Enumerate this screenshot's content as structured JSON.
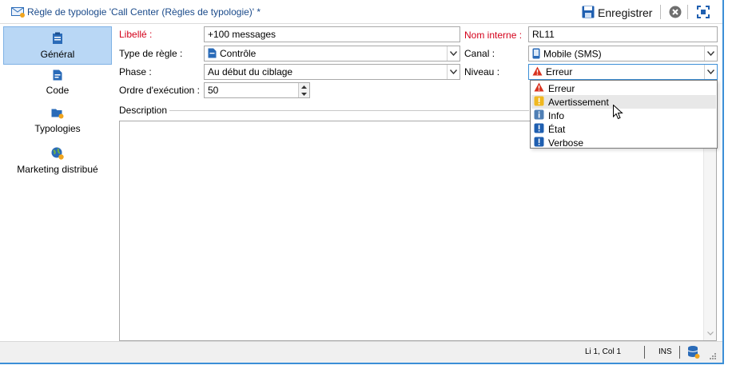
{
  "window": {
    "title": "Règle de typologie 'Call Center (Règles de typologie)' *",
    "save_label": "Enregistrer"
  },
  "toolbar": {
    "save_icon": "save-disk-icon",
    "close_icon": "close-circle-icon",
    "fullscreen_icon": "fullscreen-icon"
  },
  "nav": {
    "items": [
      {
        "label": "Général",
        "icon": "clipboard-icon",
        "selected": true
      },
      {
        "label": "Code",
        "icon": "script-icon",
        "selected": false
      },
      {
        "label": "Typologies",
        "icon": "typology-icon",
        "selected": false
      },
      {
        "label": "Marketing distribué",
        "icon": "globe-icon",
        "selected": false
      }
    ]
  },
  "form": {
    "libelle_label": "Libellé :",
    "libelle_value": "+100 messages",
    "nom_interne_label": "Nom interne :",
    "nom_interne_value": "RL11",
    "type_label": "Type de règle :",
    "type_value": "Contrôle",
    "canal_label": "Canal :",
    "canal_value": "Mobile (SMS)",
    "phase_label": "Phase :",
    "phase_value": "Au début du ciblage",
    "niveau_label": "Niveau :",
    "niveau_value": "Erreur",
    "ordre_label": "Ordre d'exécution :",
    "ordre_value": "50",
    "description_label": "Description"
  },
  "dropdown": {
    "options": [
      {
        "label": "Erreur",
        "icon": "error-triangle-icon",
        "hover": false
      },
      {
        "label": "Avertissement",
        "icon": "warning-icon",
        "hover": true
      },
      {
        "label": "Info",
        "icon": "info-icon",
        "hover": false
      },
      {
        "label": "État",
        "icon": "status-icon",
        "hover": false
      },
      {
        "label": "Verbose",
        "icon": "verbose-icon",
        "hover": false
      }
    ]
  },
  "statusbar": {
    "position": "Li 1, Col 1",
    "mode": "INS"
  },
  "colors": {
    "accent": "#3c8fd7",
    "required": "#d4001a",
    "nav_selected": "#b9d7f5"
  }
}
